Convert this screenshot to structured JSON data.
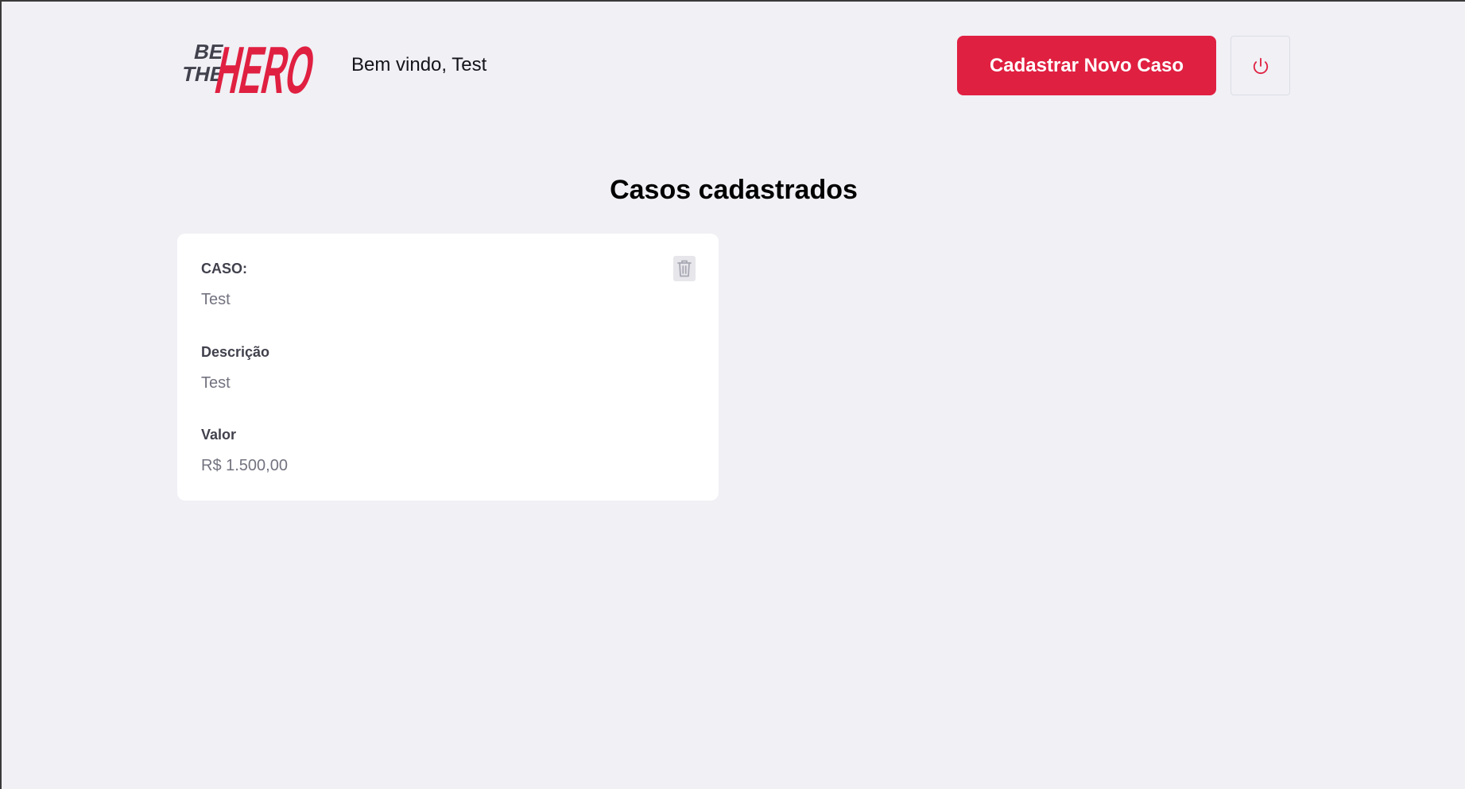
{
  "header": {
    "logo_top": "BE",
    "logo_mid": "THE",
    "logo_brand": "HERO",
    "welcome_text": "Bem vindo, Test",
    "new_case_button_label": "Cadastrar Novo Caso",
    "logout_icon": "power-icon"
  },
  "main": {
    "title": "Casos cadastrados"
  },
  "cases": [
    {
      "case_label": "CASO:",
      "case_value": "Test",
      "description_label": "Descrição",
      "description_value": "Test",
      "value_label": "Valor",
      "value_value": "R$ 1.500,00",
      "delete_icon": "trash-icon"
    }
  ],
  "colors": {
    "brand_red": "#e02041",
    "background": "#f0f0f5",
    "card": "#ffffff",
    "logo_dark": "#41414d"
  }
}
